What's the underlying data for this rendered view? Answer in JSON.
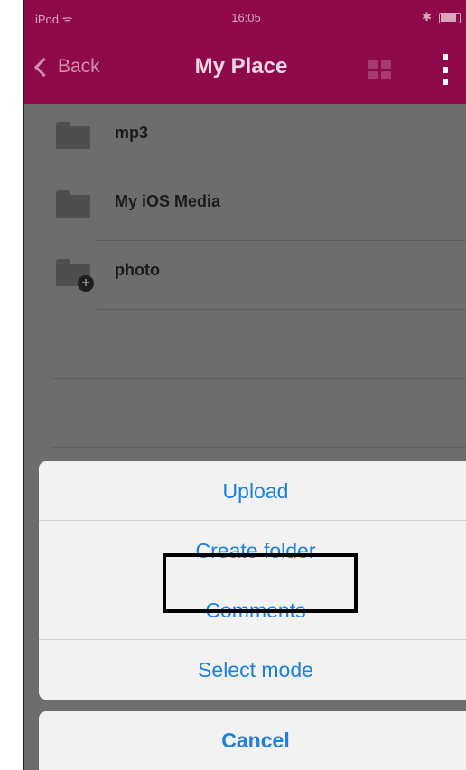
{
  "status_bar": {
    "carrier": "iPod ᯤ",
    "time": "16:05",
    "bluetooth": "✱"
  },
  "nav_bar": {
    "back_label": "Back",
    "title": "My Place",
    "grid_icon": "grid-icon",
    "more_icon": "more-vertical-icon"
  },
  "folders": [
    {
      "label": "mp3",
      "icon": "folder-icon"
    },
    {
      "label": "My iOS Media",
      "icon": "folder-icon"
    },
    {
      "label": "photo",
      "icon": "folder-add-icon"
    }
  ],
  "action_sheet": {
    "items": [
      {
        "label": "Upload"
      },
      {
        "label": "Create folder"
      },
      {
        "label": "Comments"
      },
      {
        "label": "Select mode"
      }
    ],
    "cancel_label": "Cancel"
  },
  "colors": {
    "brand": "#8f0a4a",
    "action_text": "#1a7fe0",
    "sheet_bg": "#f2f2f2"
  }
}
